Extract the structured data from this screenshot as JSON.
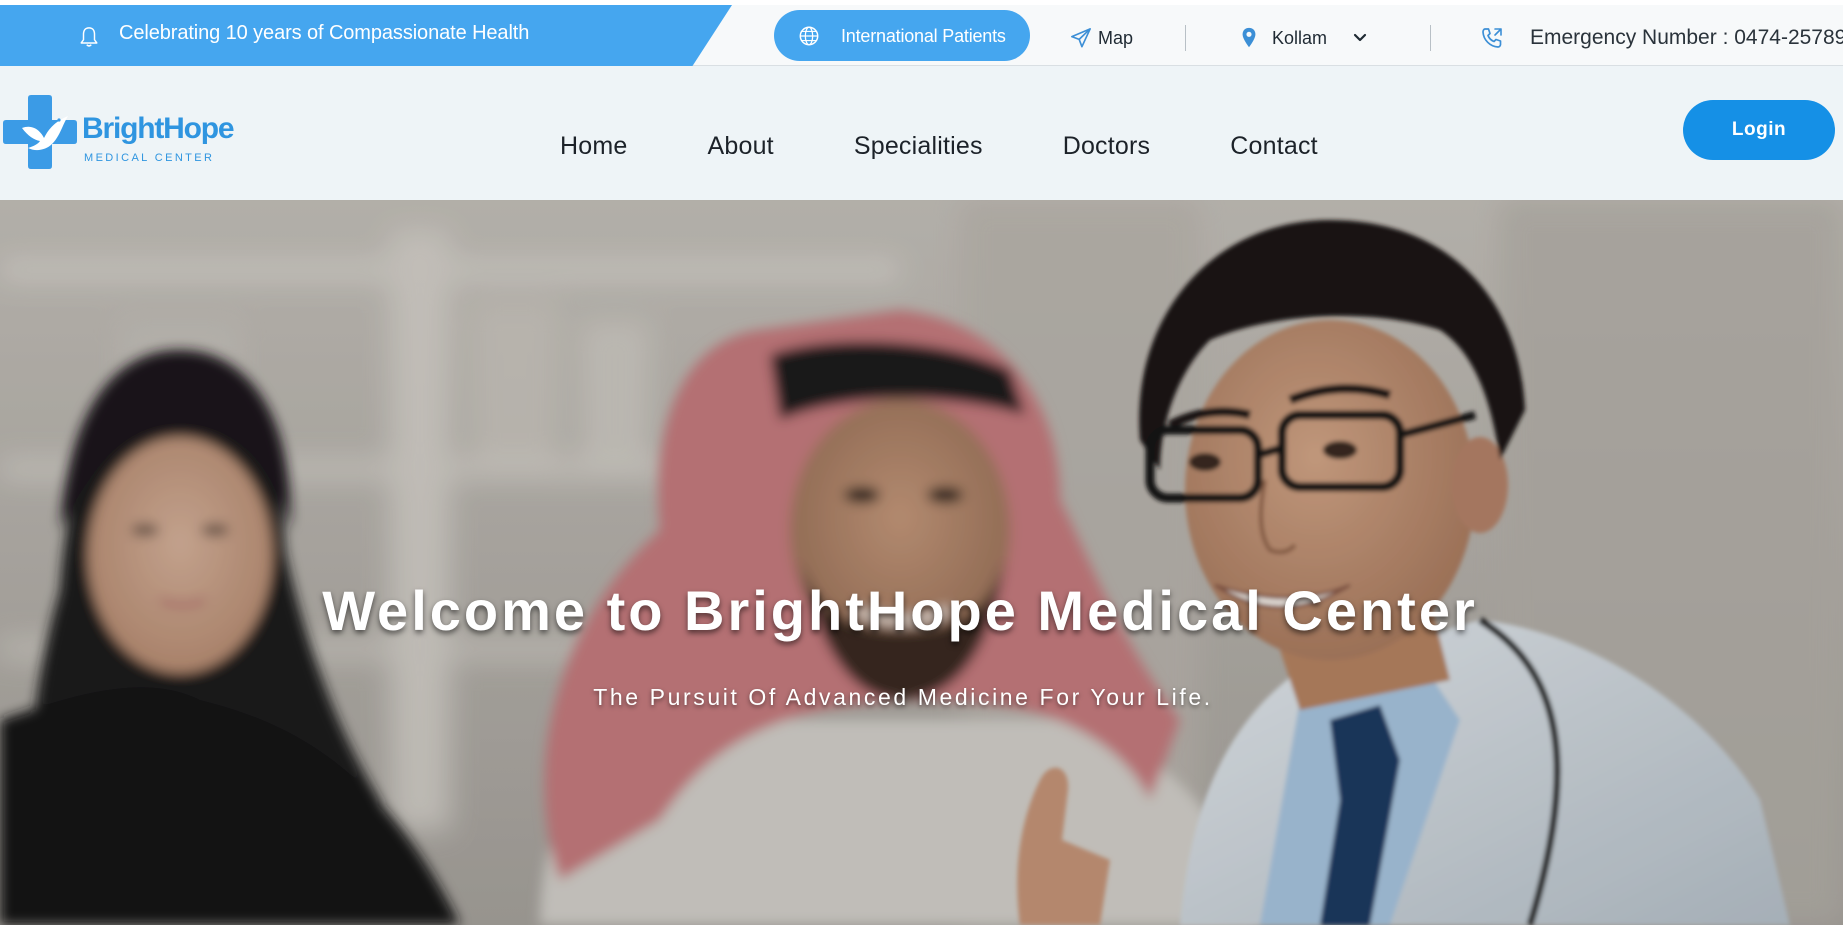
{
  "topbar": {
    "promo_text": "Celebrating 10 years of Compassionate Health",
    "international_label": "International Patients",
    "map_label": "Map",
    "location_label": "Kollam",
    "emergency_label": "Emergency Number : 0474-25789"
  },
  "nav": {
    "logo_name": "BrightHope",
    "logo_sub": "MEDICAL CENTER",
    "links": [
      "Home",
      "About",
      "Specialities",
      "Doctors",
      "Contact"
    ],
    "login_label": "Login"
  },
  "hero": {
    "title": "Welcome to BrightHope Medical Center",
    "subtitle": "The Pursuit Of Advanced Medicine For Your Life."
  },
  "icons": {
    "promo": "bell-icon",
    "international": "globe-icon",
    "map": "paper-plane-icon",
    "location": "map-pin-icon",
    "location_dropdown": "chevron-down-icon",
    "emergency": "phone-icon",
    "logo": "medical-cross-dove-icon"
  },
  "colors": {
    "brand_blue": "#45a6ef",
    "login_blue": "#1590e6",
    "logo_blue": "#2f95e0",
    "nav_bg": "#eef4f7"
  }
}
